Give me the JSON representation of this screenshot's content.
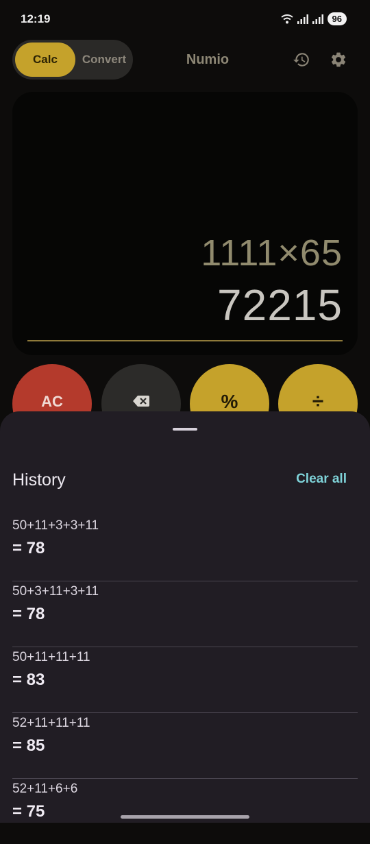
{
  "status_bar": {
    "time": "12:19",
    "battery": "96"
  },
  "header": {
    "tab_calc": "Calc",
    "tab_convert": "Convert",
    "title": "Numio"
  },
  "display": {
    "expression": "1111×65",
    "result": "72215"
  },
  "keypad": {
    "ac": "AC",
    "percent": "%",
    "divide": "÷"
  },
  "history": {
    "title": "History",
    "clear_all": "Clear all",
    "items": [
      {
        "expression": "50+11+3+3+11",
        "result": "= 78"
      },
      {
        "expression": "50+3+11+3+11",
        "result": "= 78"
      },
      {
        "expression": "50+11+11+11",
        "result": "= 83"
      },
      {
        "expression": "52+11+11+11",
        "result": "= 85"
      },
      {
        "expression": "52+11+6+6",
        "result": "= 75"
      }
    ]
  },
  "colors": {
    "accent": "#c5a22b",
    "clear_key": "#b43a2c",
    "backspace_key": "#2c2b29",
    "clear_all_link": "#7fd3d9",
    "sheet_background": "#211d24"
  }
}
